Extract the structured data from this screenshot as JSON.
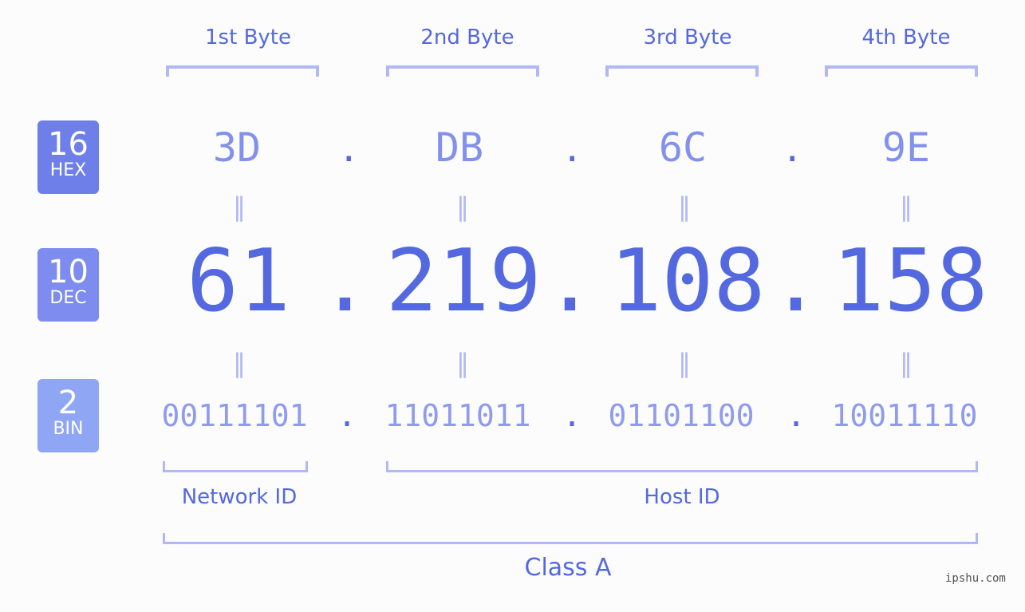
{
  "headers": [
    "1st Byte",
    "2nd Byte",
    "3rd Byte",
    "4th Byte"
  ],
  "badges": {
    "hex": {
      "num": "16",
      "label": "HEX",
      "color": "#6f7fea"
    },
    "dec": {
      "num": "10",
      "label": "DEC",
      "color": "#7d8cee"
    },
    "bin": {
      "num": "2",
      "label": "BIN",
      "color": "#8fa6f4"
    }
  },
  "hex": [
    "3D",
    "DB",
    "6C",
    "9E"
  ],
  "dec": [
    "61",
    "219",
    "108",
    "158"
  ],
  "bin": [
    "00111101",
    "11011011",
    "01101100",
    "10011110"
  ],
  "separator": ".",
  "equals": "=",
  "network_label": "Network ID",
  "host_label": "Host ID",
  "class_label": "Class A",
  "watermark": "ipshu.com"
}
